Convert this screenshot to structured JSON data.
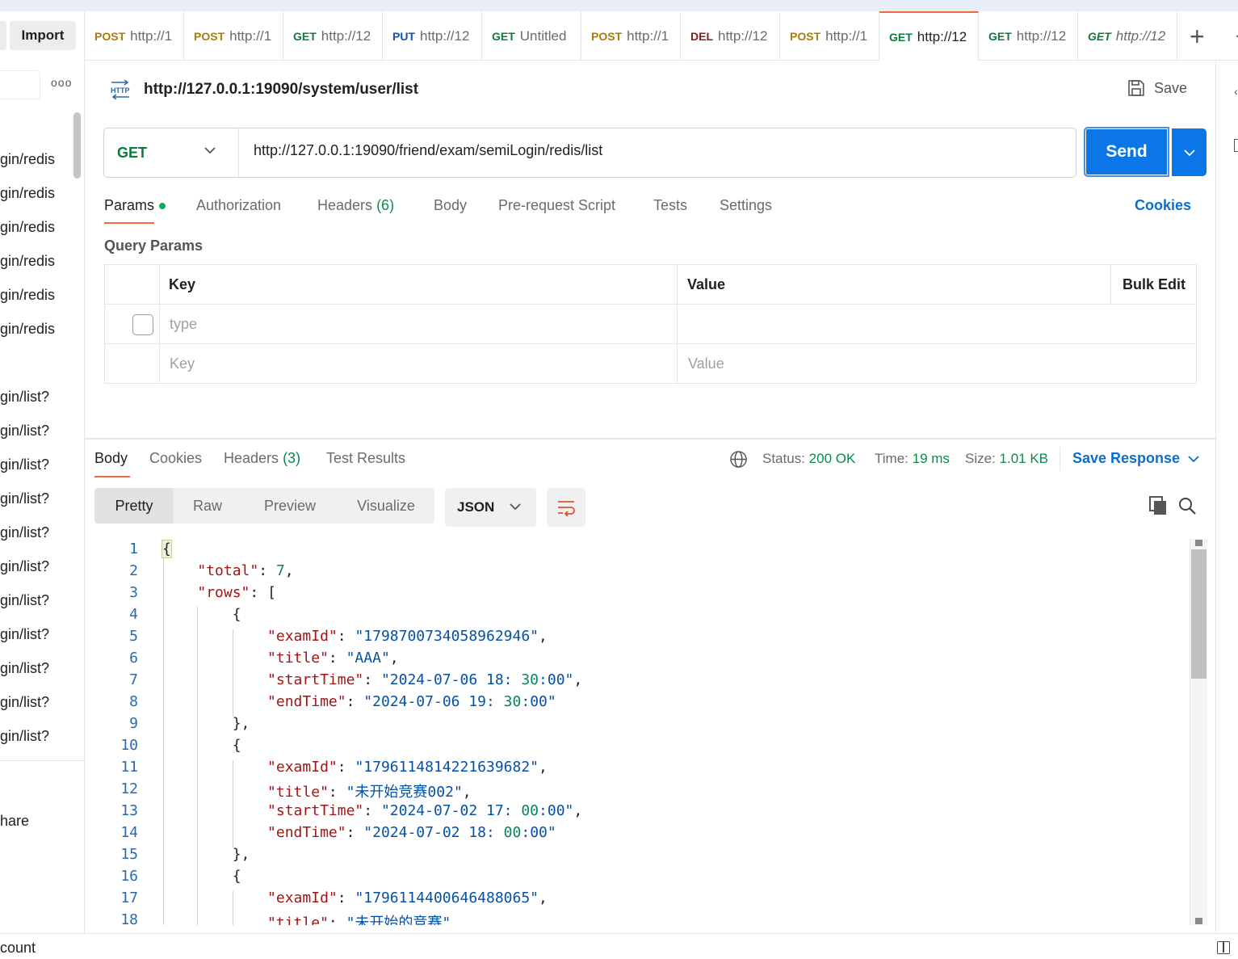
{
  "sidebar": {
    "import_label": "Import",
    "more_label": "ooo",
    "items": [
      "gin/redis",
      "gin/redis",
      "gin/redis",
      "gin/redis",
      "gin/redis",
      "gin/redis",
      "gin/list?",
      "gin/list?",
      "gin/list?",
      "gin/list?",
      "gin/list?",
      "gin/list?",
      "gin/list?",
      "gin/list?",
      "gin/list?",
      "gin/list?",
      "gin/list?"
    ],
    "share_label": "hare",
    "count_label": "count"
  },
  "tabs": [
    {
      "method": "POST",
      "url": "http://1",
      "color": "#ad7a03"
    },
    {
      "method": "POST",
      "url": "http://1",
      "color": "#ad7a03"
    },
    {
      "method": "GET",
      "url": "http://12",
      "color": "#0b7b3e"
    },
    {
      "method": "PUT",
      "url": "http://12",
      "color": "#0a55b0"
    },
    {
      "method": "GET",
      "url": "Untitled",
      "color": "#0b7b3e"
    },
    {
      "method": "POST",
      "url": "http://1",
      "color": "#ad7a03"
    },
    {
      "method": "DEL",
      "url": "http://12",
      "color": "#8b1a1a"
    },
    {
      "method": "POST",
      "url": "http://1",
      "color": "#ad7a03"
    },
    {
      "method": "GET",
      "url": "http://12",
      "color": "#0b7b3e",
      "active": true
    },
    {
      "method": "GET",
      "url": "http://12",
      "color": "#0b7b3e"
    },
    {
      "method": "GET",
      "url": "http://12",
      "color": "#0b7b3e",
      "italic": true
    }
  ],
  "request": {
    "title": "http://127.0.0.1:19090/system/user/list",
    "save_label": "Save",
    "method": "GET",
    "url": "http://127.0.0.1:19090/friend/exam/semiLogin/redis/list",
    "send_label": "Send"
  },
  "request_tabs": {
    "params": "Params",
    "authorization": "Authorization",
    "headers": "Headers",
    "headers_count": "(6)",
    "body": "Body",
    "prerequest": "Pre-request Script",
    "tests": "Tests",
    "settings": "Settings",
    "cookies": "Cookies"
  },
  "query_params": {
    "label": "Query Params",
    "col_key": "Key",
    "col_value": "Value",
    "bulk_edit": "Bulk Edit",
    "row_key": "type",
    "placeholder_key": "Key",
    "placeholder_value": "Value"
  },
  "response": {
    "tabs": {
      "body": "Body",
      "cookies": "Cookies",
      "headers": "Headers",
      "headers_count": "(3)",
      "test_results": "Test Results"
    },
    "status_label": "Status:",
    "status_value": "200 OK",
    "time_label": "Time:",
    "time_value": "19 ms",
    "size_label": "Size:",
    "size_value": "1.01 KB",
    "save_response": "Save Response",
    "views": [
      "Pretty",
      "Raw",
      "Preview",
      "Visualize"
    ],
    "format": "JSON"
  },
  "code_lines": [
    {
      "n": "1",
      "t": "{"
    },
    {
      "n": "2",
      "t": "    \"total\": 7,"
    },
    {
      "n": "3",
      "t": "    \"rows\": ["
    },
    {
      "n": "4",
      "t": "        {"
    },
    {
      "n": "5",
      "t": "            \"examId\": \"1798700734058962946\","
    },
    {
      "n": "6",
      "t": "            \"title\": \"AAA\","
    },
    {
      "n": "7",
      "t": "            \"startTime\": \"2024-07-06 18:30:00\","
    },
    {
      "n": "8",
      "t": "            \"endTime\": \"2024-07-06 19:30:00\""
    },
    {
      "n": "9",
      "t": "        },"
    },
    {
      "n": "10",
      "t": "        {"
    },
    {
      "n": "11",
      "t": "            \"examId\": \"1796114814221639682\","
    },
    {
      "n": "12",
      "t": "            \"title\": \"未开始竞赛002\","
    },
    {
      "n": "13",
      "t": "            \"startTime\": \"2024-07-02 17:00:00\","
    },
    {
      "n": "14",
      "t": "            \"endTime\": \"2024-07-02 18:00:00\""
    },
    {
      "n": "15",
      "t": "        },"
    },
    {
      "n": "16",
      "t": "        {"
    },
    {
      "n": "17",
      "t": "            \"examId\": \"1796114400646488065\","
    },
    {
      "n": "18",
      "t": "            \"title\": \"未开始的竞赛\","
    }
  ]
}
